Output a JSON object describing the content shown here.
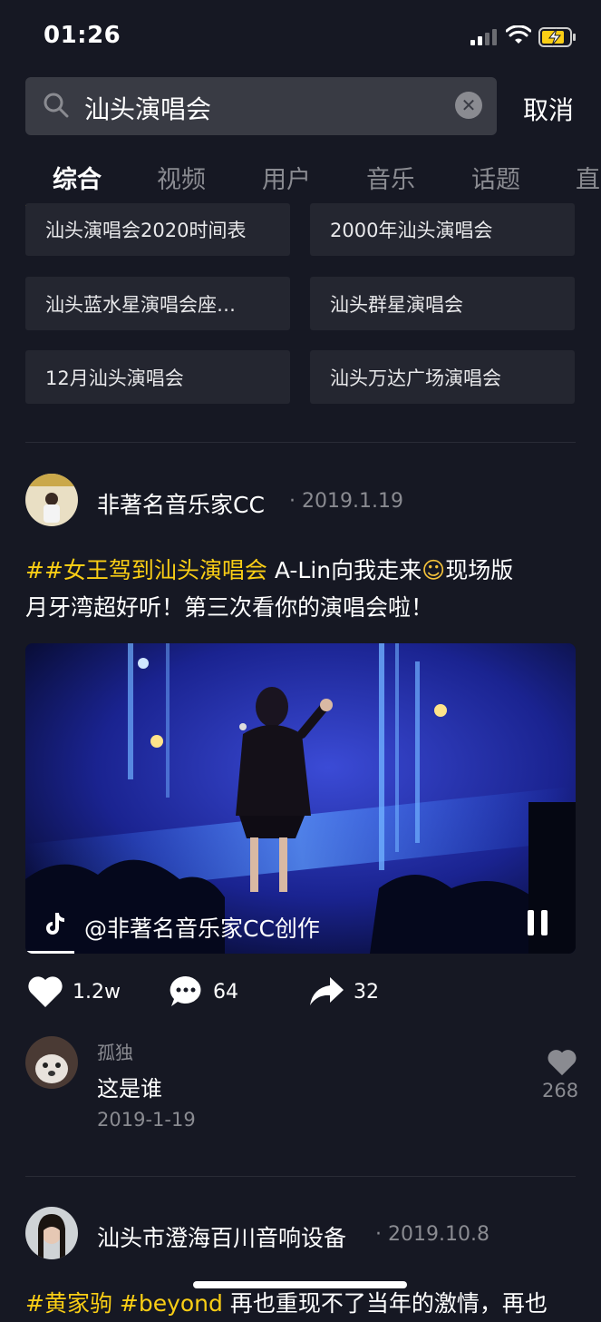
{
  "status_bar": {
    "time": "01:26"
  },
  "search": {
    "query": "汕头演唱会",
    "cancel_label": "取消"
  },
  "tabs": [
    {
      "label": "综合"
    },
    {
      "label": "视频"
    },
    {
      "label": "用户"
    },
    {
      "label": "音乐"
    },
    {
      "label": "话题"
    },
    {
      "label": "直"
    }
  ],
  "suggestions": [
    {
      "label": "汕头演唱会2020时间表"
    },
    {
      "label": "2000年汕头演唱会"
    },
    {
      "label": "汕头蓝水星演唱会座…"
    },
    {
      "label": "汕头群星演唱会"
    },
    {
      "label": "12月汕头演唱会"
    },
    {
      "label": "汕头万达广场演唱会"
    }
  ],
  "post1": {
    "author": "非著名音乐家CC",
    "date": "· 2019.1.19",
    "hashtag": "##女王驾到汕头演唱会",
    "caption_line1": " A-Lin向我走来",
    "caption_emoji": "☺",
    "caption_line1_end": "现场版",
    "caption_line2": "月牙湾超好听！第三次看你的演唱会啦！",
    "video_watermark": "@非著名音乐家CC创作",
    "likes": "1.2w",
    "comments": "64",
    "shares": "32",
    "top_comment": {
      "user": "孤独",
      "text": "这是谁",
      "date": "2019-1-19",
      "likes": "268"
    }
  },
  "post2": {
    "author": "汕头市澄海百川音响设备",
    "date": "· 2019.10.8",
    "hashtag": "#黄家驹 #beyond",
    "caption": " 再也重现不了当年的激情，再也"
  },
  "colors": {
    "background": "#161823",
    "accent_tag": "#face15",
    "chip_bg": "#242630",
    "muted_text": "#8a8b91"
  }
}
